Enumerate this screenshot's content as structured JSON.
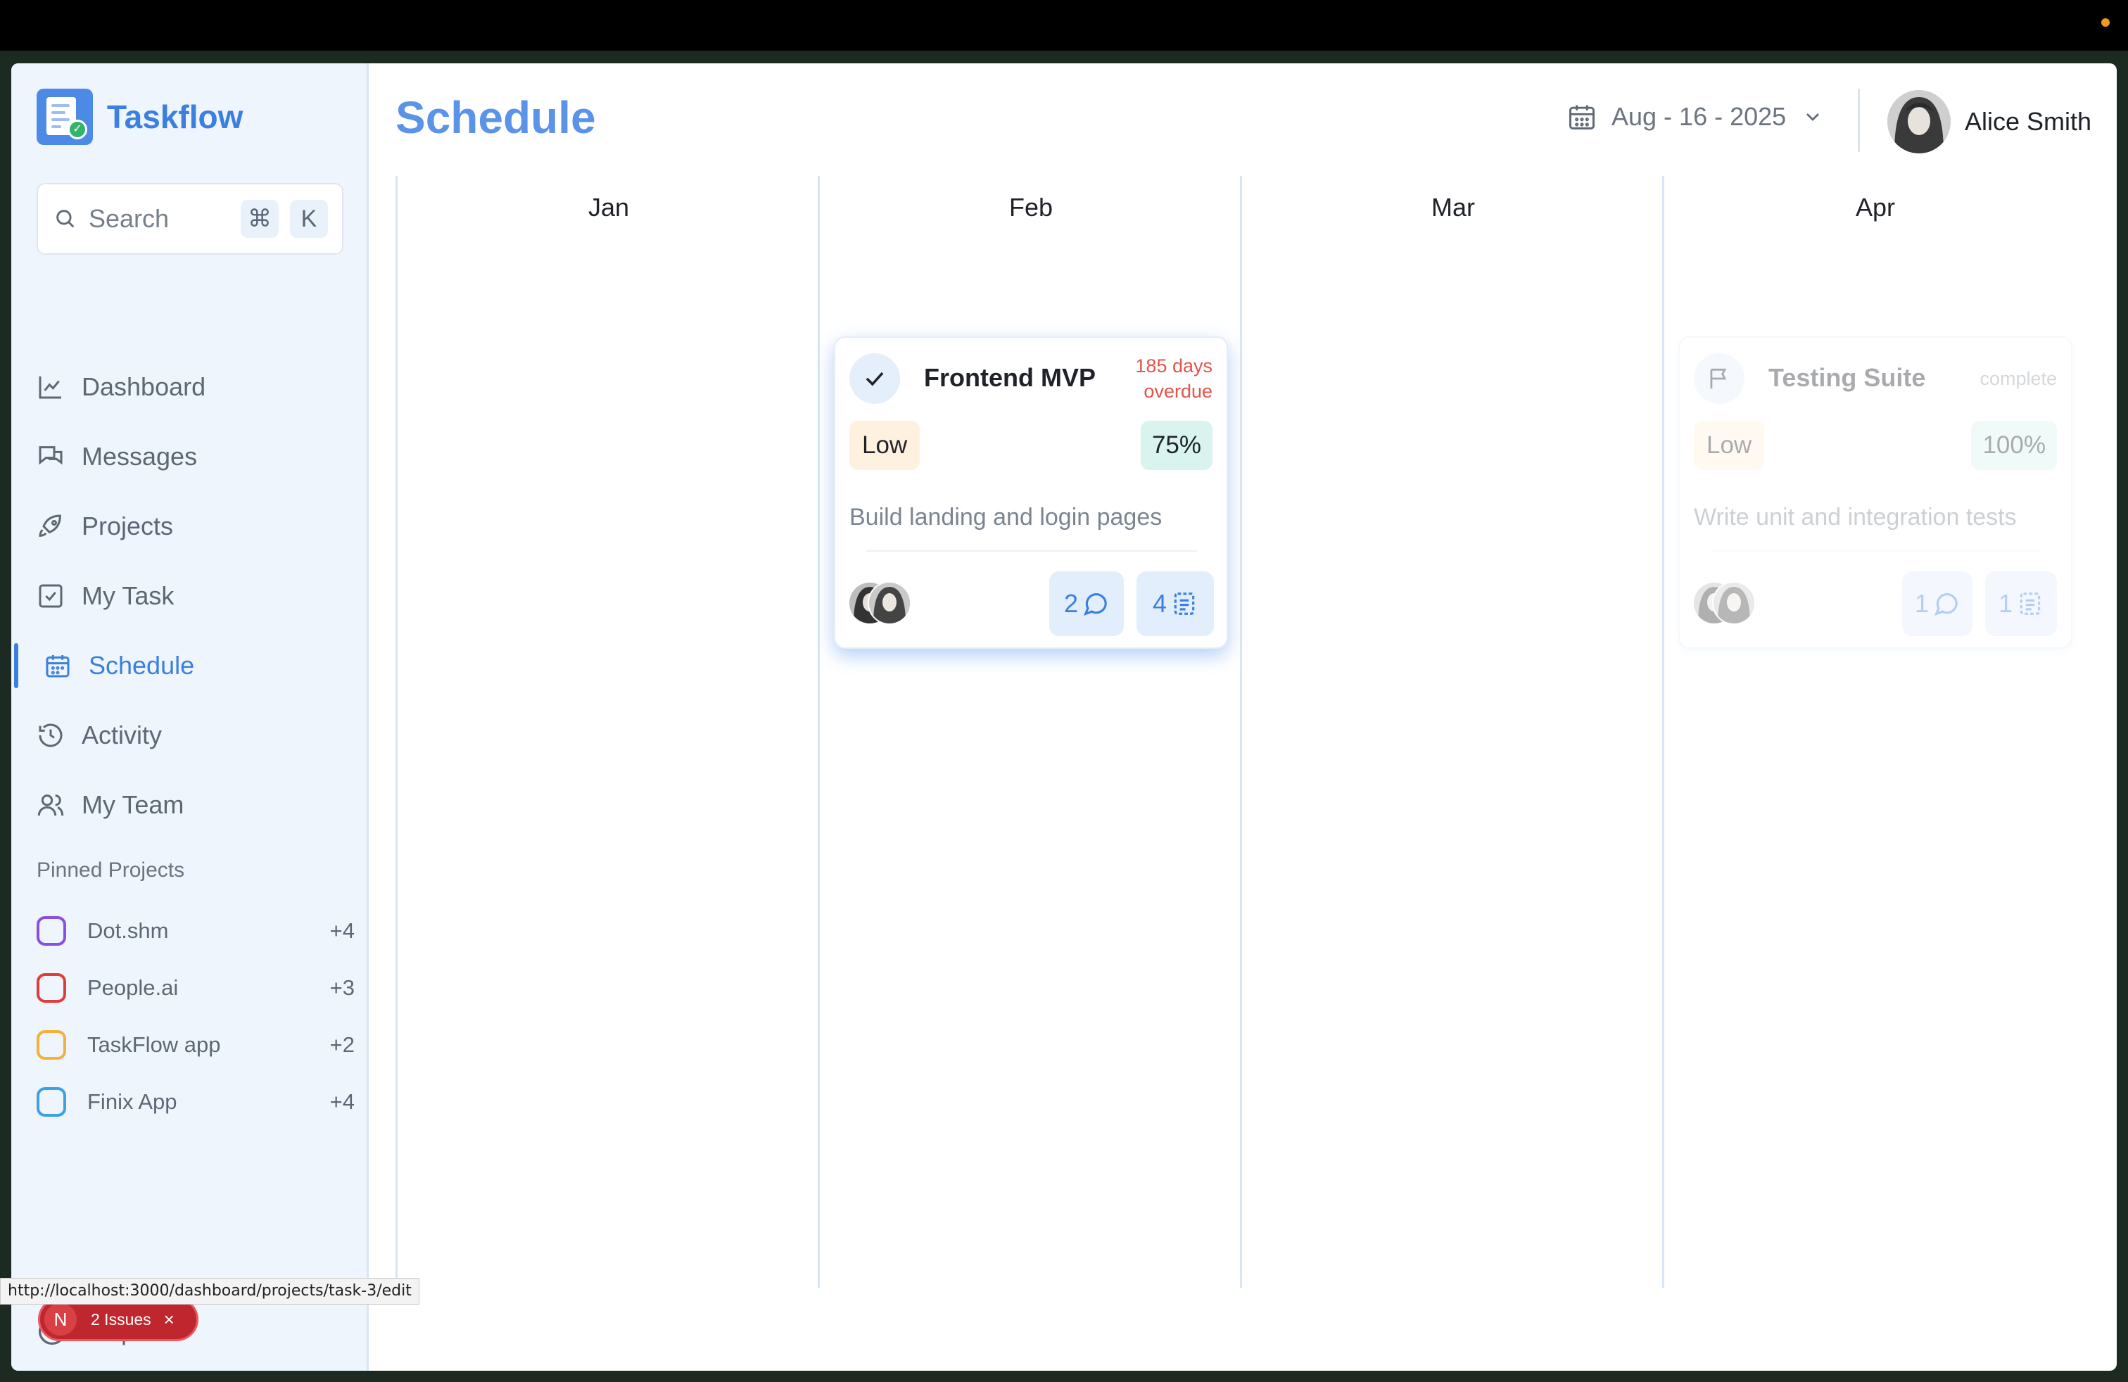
{
  "app": {
    "name": "Taskflow"
  },
  "search": {
    "placeholder": "Search",
    "shortcut_mod": "⌘",
    "shortcut_key": "K"
  },
  "nav": [
    {
      "label": "Dashboard",
      "icon": "chart-icon"
    },
    {
      "label": "Messages",
      "icon": "chat-icon"
    },
    {
      "label": "Projects",
      "icon": "rocket-icon"
    },
    {
      "label": "My Task",
      "icon": "checkbox-icon"
    },
    {
      "label": "Schedule",
      "icon": "calendar-icon",
      "active": true
    },
    {
      "label": "Activity",
      "icon": "history-icon"
    },
    {
      "label": "My Team",
      "icon": "users-icon"
    }
  ],
  "pinned": {
    "title": "Pinned Projects",
    "items": [
      {
        "name": "Dot.shm",
        "count": "+4",
        "color": "#8a4fe0"
      },
      {
        "name": "People.ai",
        "count": "+3",
        "color": "#e23b3b"
      },
      {
        "name": "TaskFlow app",
        "count": "+2",
        "color": "#f5b03a"
      },
      {
        "name": "Finix App",
        "count": "+4",
        "color": "#3ea0e6"
      }
    ]
  },
  "help": {
    "label": "Help"
  },
  "dev_overlay": {
    "badge": "N",
    "issues": "2 Issues",
    "close": "×"
  },
  "status_url": "http://localhost:3000/dashboard/projects/task-3/edit",
  "header": {
    "title": "Schedule",
    "date": "Aug - 16 - 2025",
    "user_name": "Alice Smith"
  },
  "months": [
    "Jan",
    "Feb",
    "Mar",
    "Apr"
  ],
  "cards": [
    {
      "title": "Frontend MVP",
      "due_line1": "185 days",
      "due_line2": "overdue",
      "priority": "Low",
      "progress": "75%",
      "description": "Build landing and login pages",
      "comments": "2",
      "tasks": "4"
    },
    {
      "title": "Testing Suite",
      "status": "complete",
      "priority": "Low",
      "progress": "100%",
      "description": "Write unit and integration tests",
      "comments": "1",
      "tasks": "1"
    }
  ],
  "colors": {
    "accent": "#3b7fe0",
    "overdue": "#e5534b"
  }
}
